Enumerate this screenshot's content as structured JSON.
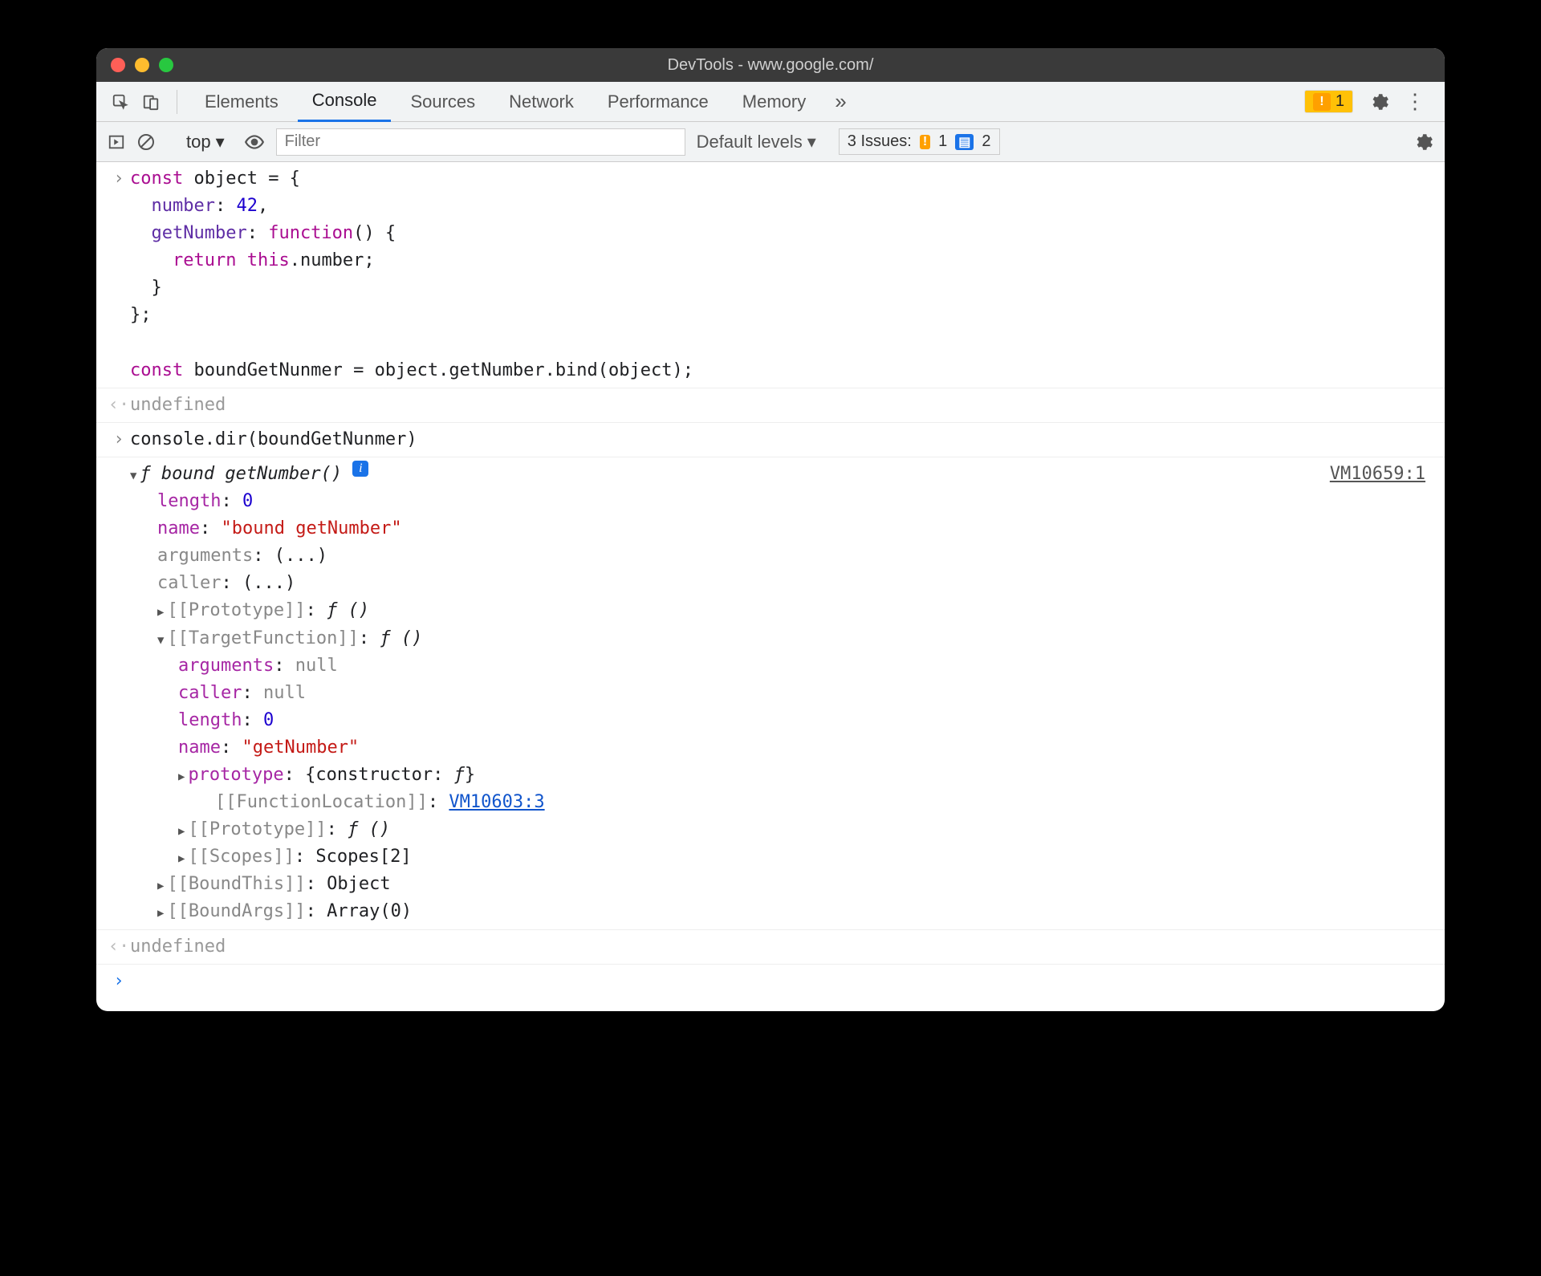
{
  "window": {
    "title": "DevTools - www.google.com/"
  },
  "tabs": {
    "elements": "Elements",
    "console": "Console",
    "sources": "Sources",
    "network": "Network",
    "performance": "Performance",
    "memory": "Memory",
    "warn_count": "1"
  },
  "toolbar": {
    "context": "top",
    "filter_placeholder": "Filter",
    "levels": "Default levels",
    "issues_label": "3 Issues:",
    "issues_warn": "1",
    "issues_info": "2"
  },
  "code": {
    "l1a": "const",
    "l1b": " object = {",
    "l2a": "  number",
    "l2b": ": ",
    "l2c": "42",
    "l2d": ",",
    "l3a": "  getNumber",
    "l3b": ": ",
    "l3c": "function",
    "l3d": "() {",
    "l4a": "    ",
    "l4b": "return",
    "l4c": " ",
    "l4d": "this",
    "l4e": ".number;",
    "l5": "  }",
    "l6": "};",
    "l8a": "const",
    "l8b": " boundGetNunmer = object.getNumber.bind(object);"
  },
  "result1": "undefined",
  "cmd2": "console.dir(boundGetNunmer)",
  "vm_link": "VM10659:1",
  "tree": {
    "header_fn": "ƒ bound getNumber()",
    "length_k": "length",
    "length_v": "0",
    "name_k": "name",
    "name_v": "\"bound getNumber\"",
    "arguments_k": "arguments",
    "arguments_v": "(...)",
    "caller_k": "caller",
    "caller_v": "(...)",
    "proto1_k": "[[Prototype]]",
    "proto1_v": "ƒ ()",
    "target_k": "[[TargetFunction]]",
    "target_v": "ƒ ()",
    "t_arguments_k": "arguments",
    "t_arguments_v": "null",
    "t_caller_k": "caller",
    "t_caller_v": "null",
    "t_length_k": "length",
    "t_length_v": "0",
    "t_name_k": "name",
    "t_name_v": "\"getNumber\"",
    "t_proto_k": "prototype",
    "t_proto_v_pre": "{constructor: ",
    "t_proto_v_fn": "ƒ",
    "t_proto_v_post": "}",
    "t_loc_k": "[[FunctionLocation]]",
    "t_loc_v": "VM10603:3",
    "t_proto2_k": "[[Prototype]]",
    "t_proto2_v": "ƒ ()",
    "t_scopes_k": "[[Scopes]]",
    "t_scopes_v": "Scopes[2]",
    "bthis_k": "[[BoundThis]]",
    "bthis_v": "Object",
    "bargs_k": "[[BoundArgs]]",
    "bargs_v": "Array(0)"
  },
  "result2": "undefined"
}
